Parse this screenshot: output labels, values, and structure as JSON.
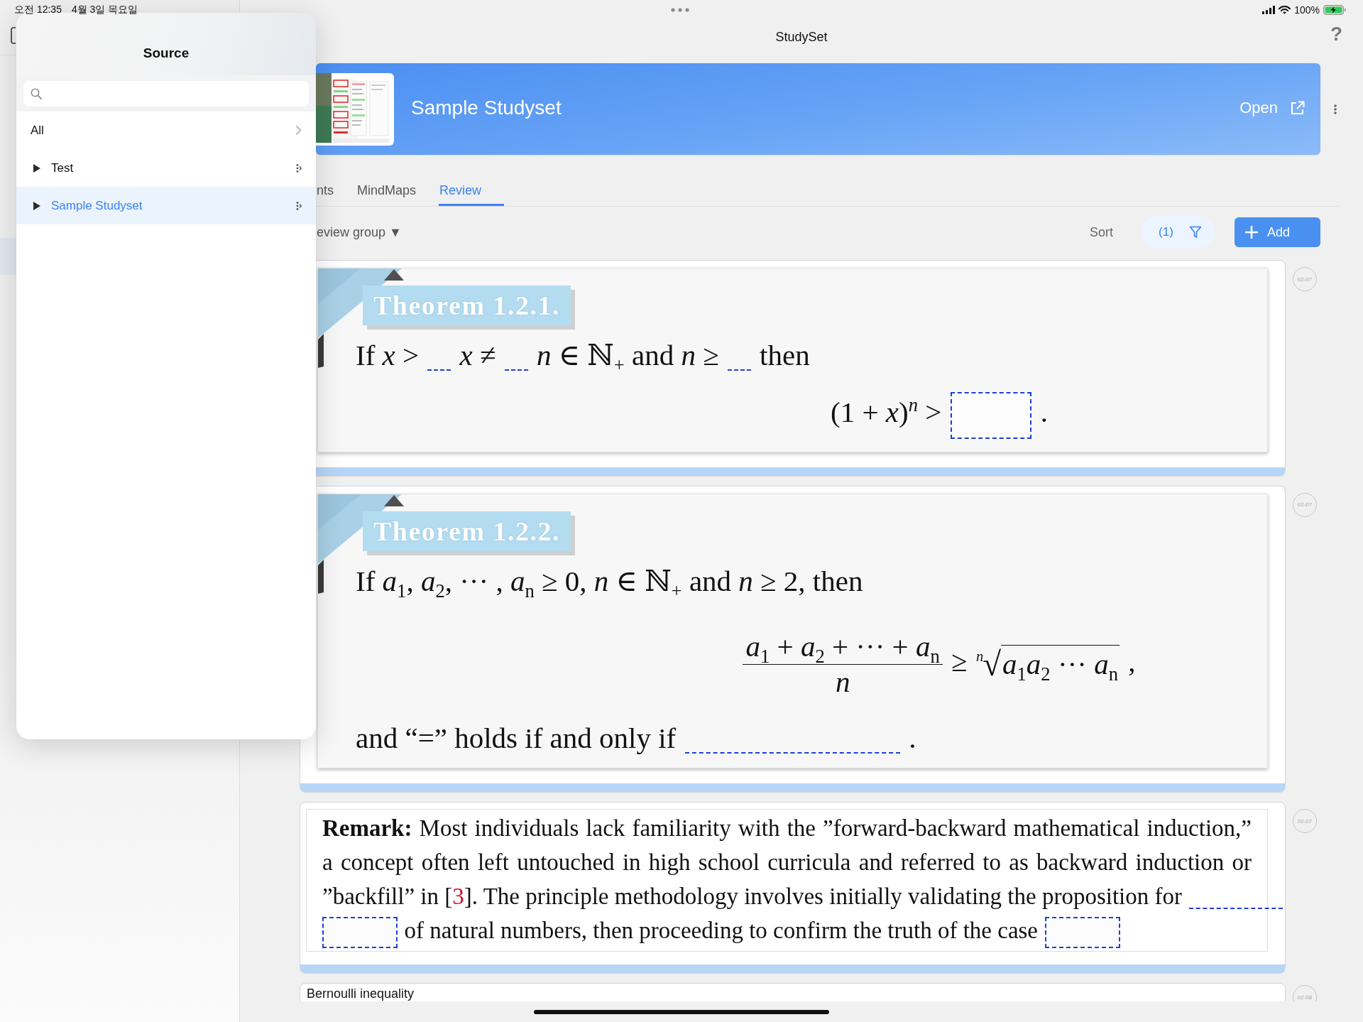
{
  "status_bar": {
    "time": "오전 12:35",
    "date": "4월 3일 목요일",
    "battery": "100%"
  },
  "nav_bar": {
    "title": "StudySet",
    "help_button": "?"
  },
  "source_popover": {
    "title": "Source",
    "search": {
      "focused": false
    },
    "items": [
      {
        "kind": "link",
        "label": "All",
        "selected": false
      },
      {
        "kind": "group",
        "label": "Test",
        "expanded": false,
        "selected": false
      },
      {
        "kind": "group",
        "label": "Sample Studyset",
        "expanded": false,
        "selected": true
      }
    ]
  },
  "banner": {
    "title": "Sample Studyset",
    "open_button": "Open"
  },
  "tabs": [
    {
      "label": "nts",
      "selected": false
    },
    {
      "label": "MindMaps",
      "selected": false
    },
    {
      "label": "Review",
      "selected": true
    }
  ],
  "toolbar": {
    "group_menu": "eview group ▼",
    "sort_button": "Sort",
    "filter_button": "(1)",
    "add_button": "Add"
  },
  "cards": [
    {
      "kind": "theorem",
      "label": "Theorem 1.2.1.",
      "date": "02-07",
      "lines": [
        {
          "kind": "text",
          "parts": [
            {
              "kind": "text",
              "text": "If *x* >"
            },
            {
              "kind": "blank"
            },
            {
              "kind": "text",
              "text": "*x* ≠"
            },
            {
              "kind": "blank"
            },
            {
              "kind": "text",
              "text": "*n* ∈ ℕ$_{+}$ and *n* ≥"
            },
            {
              "kind": "blank"
            },
            {
              "kind": "text",
              "text": "then"
            }
          ]
        },
        {
          "kind": "display",
          "parts": [
            {
              "kind": "text",
              "text": "(1 + *x*)$^{n}$ >"
            },
            {
              "kind": "box"
            },
            {
              "kind": "text",
              "text": "."
            }
          ]
        }
      ]
    },
    {
      "kind": "theorem",
      "label": "Theorem 1.2.2.",
      "date": "02-07",
      "lines": [
        {
          "kind": "text",
          "parts": [
            {
              "kind": "text",
              "text": "If *a*$_{1}$, *a*$_{2}$, ··· , *a*$_{n}$ ≥ 0, *n* ∈ ℕ$_{+}$ and *n* ≥ 2, then"
            }
          ]
        },
        {
          "kind": "display",
          "parts": [
            {
              "kind": "fraction",
              "numerator": "*a*$_{1}$ + *a*$_{2}$ + ··· + *a*$_{n}$",
              "denominator": "*n*"
            },
            {
              "kind": "text",
              "text": "≥"
            },
            {
              "kind": "root",
              "index": "*n*",
              "sign": "√",
              "radicand": "*a*$_{1}$*a*$_{2}$ ··· *a*$_{n}$"
            },
            {
              "kind": "text",
              "text": ","
            }
          ]
        },
        {
          "kind": "text",
          "parts": [
            {
              "kind": "text",
              "text": "and “=” holds if and only if"
            },
            {
              "kind": "rule"
            },
            {
              "kind": "text",
              "text": "."
            }
          ]
        }
      ]
    },
    {
      "kind": "remark",
      "date": "02-07",
      "lines": [
        {
          "kind": "text",
          "parts": [
            {
              "kind": "text",
              "text": "**Remark:** Most individuals lack familiarity with the ”forward-backward mathematical induction,”"
            }
          ]
        },
        {
          "kind": "text",
          "parts": [
            {
              "kind": "text",
              "text": "a concept often left untouched in high school curricula and referred to as backward induction or"
            }
          ]
        },
        {
          "kind": "text",
          "parts": [
            {
              "kind": "text",
              "text": "”backfill” in ["
            },
            {
              "kind": "cite",
              "text": "3"
            },
            {
              "kind": "text",
              "text": "]. The principle methodology involves initially validating the proposition for"
            },
            {
              "kind": "rule"
            }
          ]
        },
        {
          "kind": "text",
          "parts": [
            {
              "kind": "box"
            },
            {
              "kind": "text",
              "text": "of natural numbers, then proceeding to confirm the truth of the case"
            },
            {
              "kind": "box"
            }
          ]
        }
      ]
    },
    {
      "kind": "note",
      "title": "Bernoulli inequality",
      "date": "02-08"
    }
  ]
}
